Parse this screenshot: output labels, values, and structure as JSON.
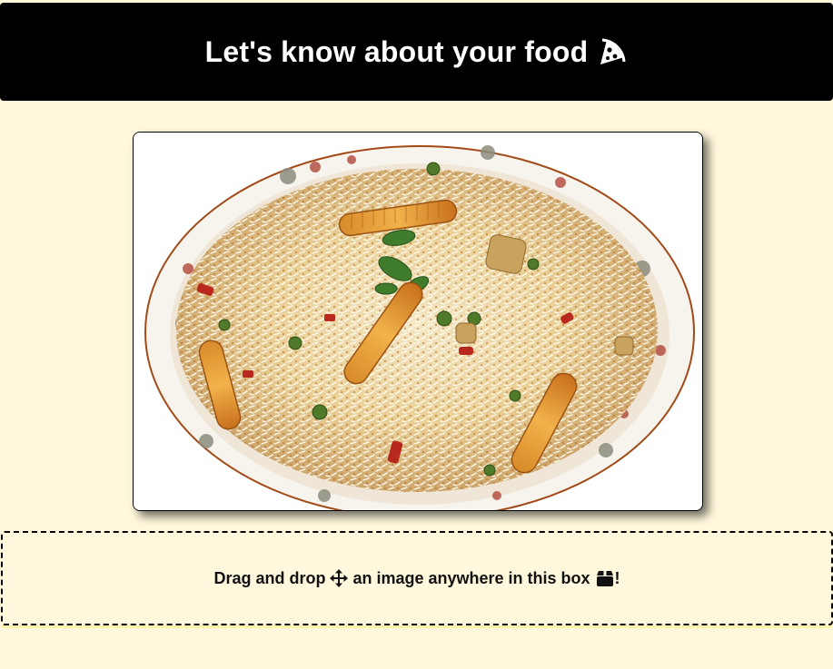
{
  "header": {
    "title": "Let's know about your food",
    "icon": "pizza-slice-icon"
  },
  "main": {
    "photo": {
      "subject": "plate-of-vegetable-biryani-image"
    }
  },
  "dropzone": {
    "text_before": "Drag and drop",
    "move_icon": "arrows-move-icon",
    "text_middle": "an image anywhere in this box",
    "box_icon": "box-icon",
    "text_after": "!"
  },
  "colors": {
    "background": "#fff8dc",
    "header_bg": "#000000",
    "header_text": "#ffffff"
  }
}
